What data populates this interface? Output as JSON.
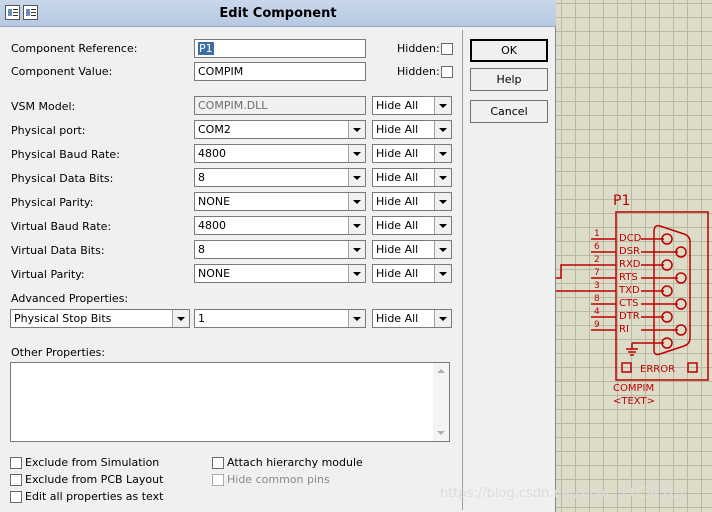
{
  "dialog": {
    "title": "Edit Component",
    "component_reference": {
      "label": "Component Reference:",
      "value": "P1",
      "hidden_label": "Hidden:",
      "hidden": false
    },
    "component_value": {
      "label": "Component Value:",
      "value": "COMPIM",
      "hidden_label": "Hidden:",
      "hidden": false
    },
    "rows": [
      {
        "label": "VSM Model:",
        "value": "COMPIM.DLL",
        "readonly": true,
        "visibility": "Hide All"
      },
      {
        "label": "Physical port:",
        "value": "COM2",
        "visibility": "Hide All"
      },
      {
        "label": "Physical Baud Rate:",
        "value": "4800",
        "visibility": "Hide All"
      },
      {
        "label": "Physical Data Bits:",
        "value": "8",
        "visibility": "Hide All"
      },
      {
        "label": "Physical Parity:",
        "value": "NONE",
        "visibility": "Hide All"
      },
      {
        "label": "Virtual Baud Rate:",
        "value": "4800",
        "visibility": "Hide All"
      },
      {
        "label": "Virtual Data Bits:",
        "value": "8",
        "visibility": "Hide All"
      },
      {
        "label": "Virtual Parity:",
        "value": "NONE",
        "visibility": "Hide All"
      }
    ],
    "advanced": {
      "label": "Advanced Properties:",
      "property": "Physical Stop Bits",
      "value": "1",
      "visibility": "Hide All"
    },
    "other_properties": {
      "label": "Other Properties:",
      "text": ""
    },
    "checkboxes": {
      "exclude_simulation": "Exclude from Simulation",
      "exclude_pcb": "Exclude from PCB Layout",
      "edit_all": "Edit all properties as text",
      "attach_hierarchy": "Attach hierarchy module",
      "hide_common_pins": "Hide common pins"
    },
    "buttons": {
      "ok": "OK",
      "help": "Help",
      "cancel": "Cancel"
    }
  },
  "schematic": {
    "ref": "P1",
    "pins": [
      {
        "num": "1",
        "name": "DCD"
      },
      {
        "num": "6",
        "name": "DSR"
      },
      {
        "num": "2",
        "name": "RXD"
      },
      {
        "num": "7",
        "name": "RTS"
      },
      {
        "num": "3",
        "name": "TXD"
      },
      {
        "num": "8",
        "name": "CTS"
      },
      {
        "num": "4",
        "name": "DTR"
      },
      {
        "num": "9",
        "name": "RI"
      }
    ],
    "error_label": "ERROR",
    "part_name": "COMPIM",
    "text_placeholder": "<TEXT>",
    "color": "#c00000"
  },
  "watermark": "https://blog.csdn.net/sinat_33734313"
}
